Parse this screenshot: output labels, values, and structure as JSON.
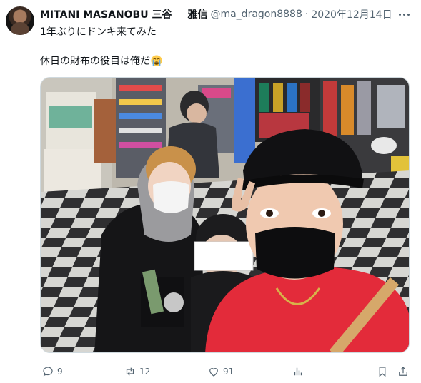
{
  "tweet": {
    "author_name": "MITANI MASANOBU 三谷",
    "author_name_2": "雅信",
    "handle": "@ma_dragon8888",
    "separator": "·",
    "date": "2020年12月14日",
    "line1": "1年ぶりにドンキ来てみた",
    "line2": "休日の財布の役目は俺だ"
  },
  "icons": {
    "avatar": "user-avatar",
    "more": "more-icon",
    "emoji": "crying-face-emoji",
    "reply": "reply-icon",
    "retweet": "retweet-icon",
    "like": "heart-icon",
    "views": "views-icon",
    "bookmark": "bookmark-icon",
    "share": "share-icon"
  },
  "actions": {
    "replies": "9",
    "retweets": "12",
    "likes": "91"
  },
  "colors": {
    "text": "#0f1419",
    "muted": "#536471",
    "border": "#cfd9de"
  }
}
